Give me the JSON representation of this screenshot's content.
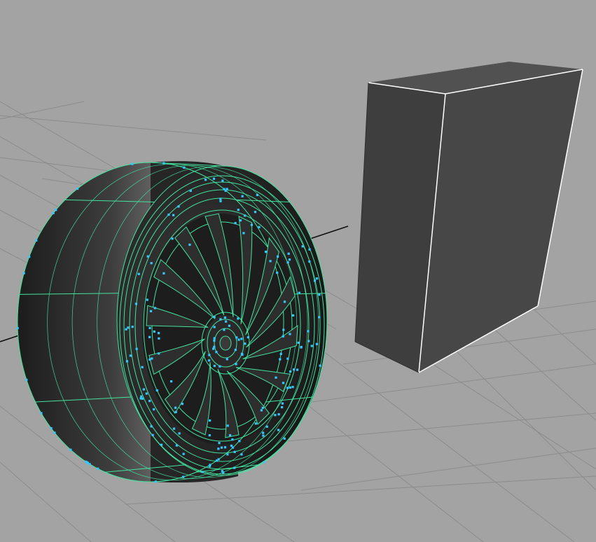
{
  "viewport": {
    "name": "perspective-viewport",
    "background_color": "#a3a3a3",
    "grid_color": "#8c8c8c",
    "axis_color": "#111111"
  },
  "objects": [
    {
      "name": "tire-wheel-mesh",
      "selected": true,
      "shape": "wheel",
      "spoke_count": 14,
      "surface_color": "#2b2b2b",
      "wireframe_color": "#43e3a0",
      "vertex_color": "#35c8ff"
    },
    {
      "name": "box-mesh",
      "selected": false,
      "shape": "cube",
      "face_front_color": "#474747",
      "face_side_color": "#3e3e3e",
      "face_top_color": "#515151",
      "edge_color": "#ffffff"
    }
  ]
}
